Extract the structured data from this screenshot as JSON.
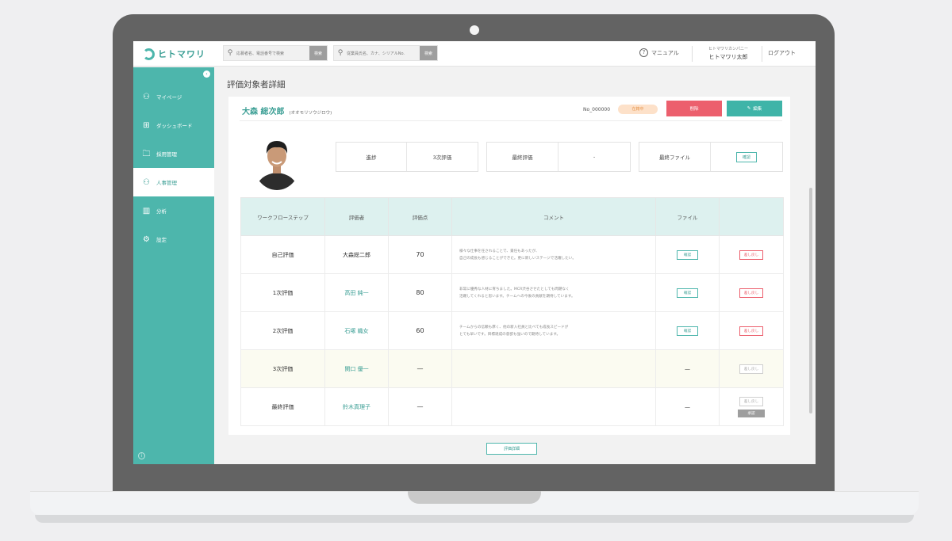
{
  "app": {
    "logo_text": "ヒトマワリ",
    "colors": {
      "brand": "#4db6ac",
      "danger": "#ec5f6d",
      "badge_bg": "#fde1c9"
    }
  },
  "header": {
    "search1_placeholder": "応募者名、電話番号で検索",
    "search2_placeholder": "従業員氏名、カナ、シリアルNo.",
    "search_button": "検索",
    "manual_label": "マニュアル",
    "company_name": "ヒトマワリカンパニー",
    "user_name": "ヒトマワリ太郎",
    "logout_label": "ログアウト"
  },
  "sidebar": {
    "items": [
      {
        "label": "マイページ",
        "icon": "user-icon",
        "active": false
      },
      {
        "label": "ダッシュボード",
        "icon": "dashboard-icon",
        "active": false
      },
      {
        "label": "採用管理",
        "icon": "folder-icon",
        "active": false
      },
      {
        "label": "人事管理",
        "icon": "people-icon",
        "active": true
      },
      {
        "label": "分析",
        "icon": "chart-icon",
        "active": false
      },
      {
        "label": "設定",
        "icon": "gear-icon",
        "active": false
      }
    ]
  },
  "page": {
    "title": "評価対象者詳細",
    "employee_name": "大森 総次郎",
    "employee_kana": "(オオモリソウジロウ)",
    "employee_no": "No_000000",
    "status_badge": "在籍中",
    "delete_label": "削除",
    "edit_label": "編集",
    "summary": {
      "progress_label": "進捗",
      "progress_value": "3次評価",
      "final_label": "最終評価",
      "final_value": "-",
      "file_label": "最終ファイル",
      "file_button": "確認"
    },
    "detail_button": "評価詳細"
  },
  "table": {
    "headers": [
      "ワークフローステップ",
      "評価者",
      "評価点",
      "コメント",
      "ファイル",
      ""
    ],
    "rows": [
      {
        "step": "自己評価",
        "reviewer": "大森総二郎",
        "score": "70",
        "comment_1": "様々な仕事を任されることで、責任もあったが、",
        "comment_2": "自己の成長も感じることができた。更に新しいステージで活躍したい。",
        "file": "確認",
        "action": "差し戻し"
      },
      {
        "step": "1次評価",
        "reviewer": "高田 純一",
        "score": "80",
        "comment_1": "非常に優秀な人材に育ちました。MCR渋谷させたとしても問題なく",
        "comment_2": "活躍してくれると思います。チームへの今後の貢献を期待しています。",
        "file": "確認",
        "action": "差し戻し"
      },
      {
        "step": "2次評価",
        "reviewer": "石塚 織女",
        "score": "60",
        "comment_1": "チームからの信頼も厚く、他の新入社員と比べても成長スピードが",
        "comment_2": "とても早いです。目標達成の意欲も強いので期待しています。",
        "file": "確認",
        "action": "差し戻し"
      },
      {
        "step": "3次評価",
        "reviewer": "関口 優一",
        "score": "—",
        "comment_1": "",
        "comment_2": "",
        "file": "—",
        "action": "差し戻し"
      },
      {
        "step": "最終評価",
        "reviewer": "鈴木真理子",
        "score": "—",
        "comment_1": "",
        "comment_2": "",
        "file": "—",
        "action": "差し戻し",
        "extra_action": "承認"
      }
    ]
  }
}
